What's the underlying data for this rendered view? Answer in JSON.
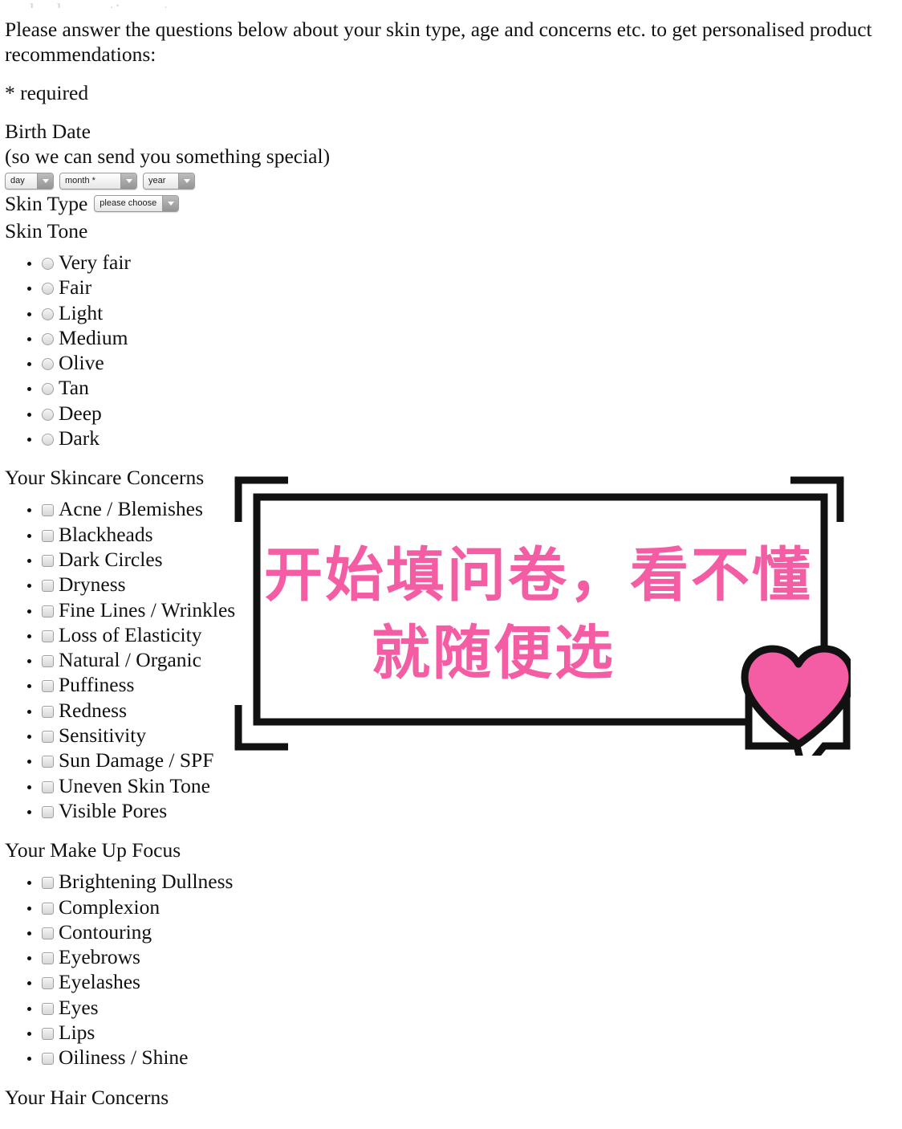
{
  "document": {
    "clipped_top_line": "and ask questions etc.",
    "intro": "Please answer the questions below about your skin type, age and concerns etc. to get personalised product recommendations:",
    "required_note": "* required"
  },
  "birth_date": {
    "label": "Birth Date",
    "sublabel": "(so we can send you something special)",
    "day_select": {
      "value": "day",
      "name": "day-select"
    },
    "month_select": {
      "value": "month *",
      "name": "month-select"
    },
    "year_select": {
      "value": "year",
      "name": "year-select"
    }
  },
  "skin_type": {
    "label": "Skin Type",
    "select": {
      "value": "please choose"
    }
  },
  "skin_tone": {
    "label": "Skin Tone",
    "options": [
      "Very fair",
      "Fair",
      "Light",
      "Medium",
      "Olive",
      "Tan",
      "Deep",
      "Dark"
    ]
  },
  "skincare_concerns": {
    "label": "Your Skincare Concerns",
    "options": [
      "Acne / Blemishes",
      "Blackheads",
      "Dark Circles",
      "Dryness",
      "Fine Lines / Wrinkles",
      "Loss of Elasticity",
      "Natural / Organic",
      "Puffiness",
      "Redness",
      "Sensitivity",
      "Sun Damage / SPF",
      "Uneven Skin Tone",
      "Visible Pores"
    ]
  },
  "makeup_focus": {
    "label": "Your Make Up Focus",
    "options": [
      "Brightening Dullness",
      "Complexion",
      "Contouring",
      "Eyebrows",
      "Eyelashes",
      "Eyes",
      "Lips",
      "Oiliness / Shine"
    ]
  },
  "hair_concerns": {
    "label": "Your Hair Concerns"
  },
  "annotation": {
    "line1": "开始填问卷，看不懂",
    "line2": "就随便选",
    "pink": "#F45DA3",
    "frame_color": "#111111",
    "heart_icon": "heart-icon"
  }
}
